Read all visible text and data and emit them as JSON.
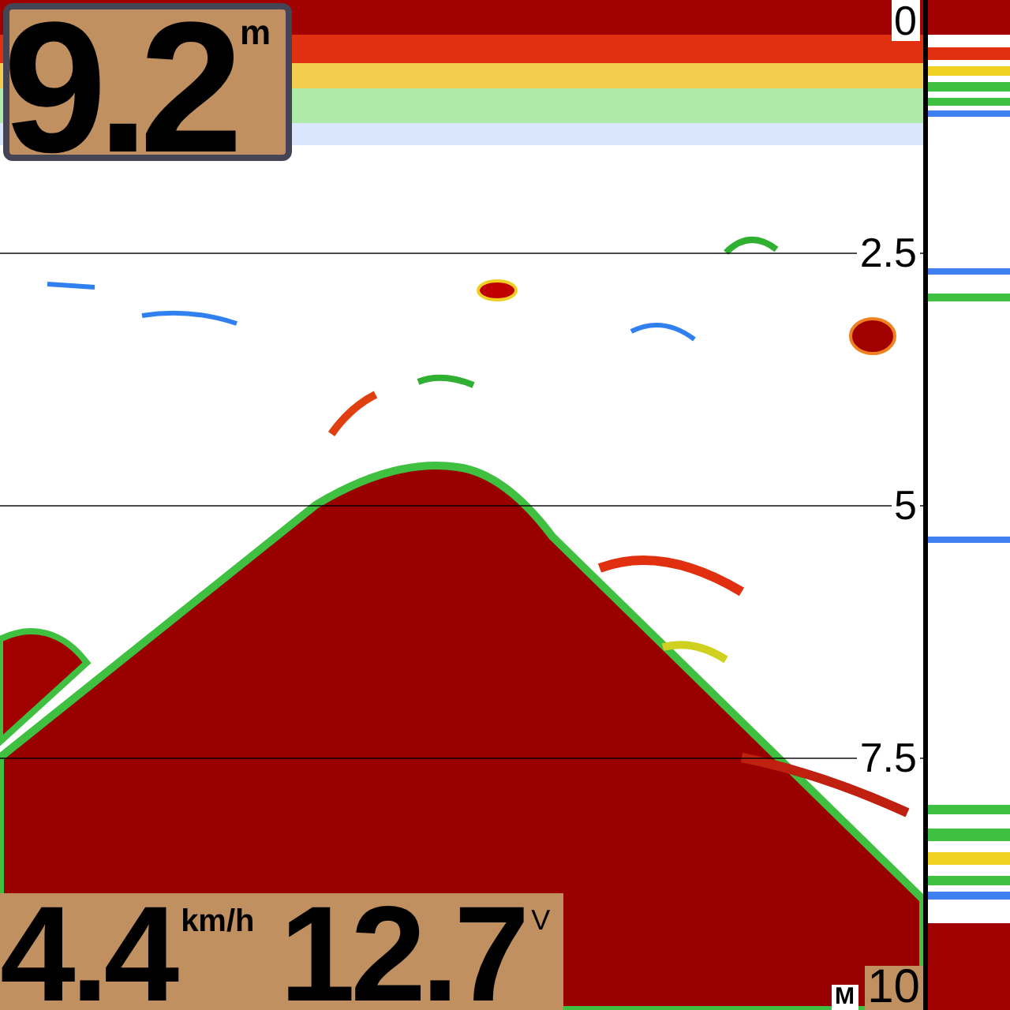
{
  "depth": {
    "value": "9.2",
    "unit": "m"
  },
  "scale": [
    {
      "label": "0"
    },
    {
      "label": "2.5"
    },
    {
      "label": "5"
    },
    {
      "label": "7.5"
    },
    {
      "label": "10"
    }
  ],
  "range_mode": "M",
  "speed": {
    "value": "4.4",
    "unit": "km/h"
  },
  "voltage": {
    "value": "12.7",
    "unit": "V"
  }
}
